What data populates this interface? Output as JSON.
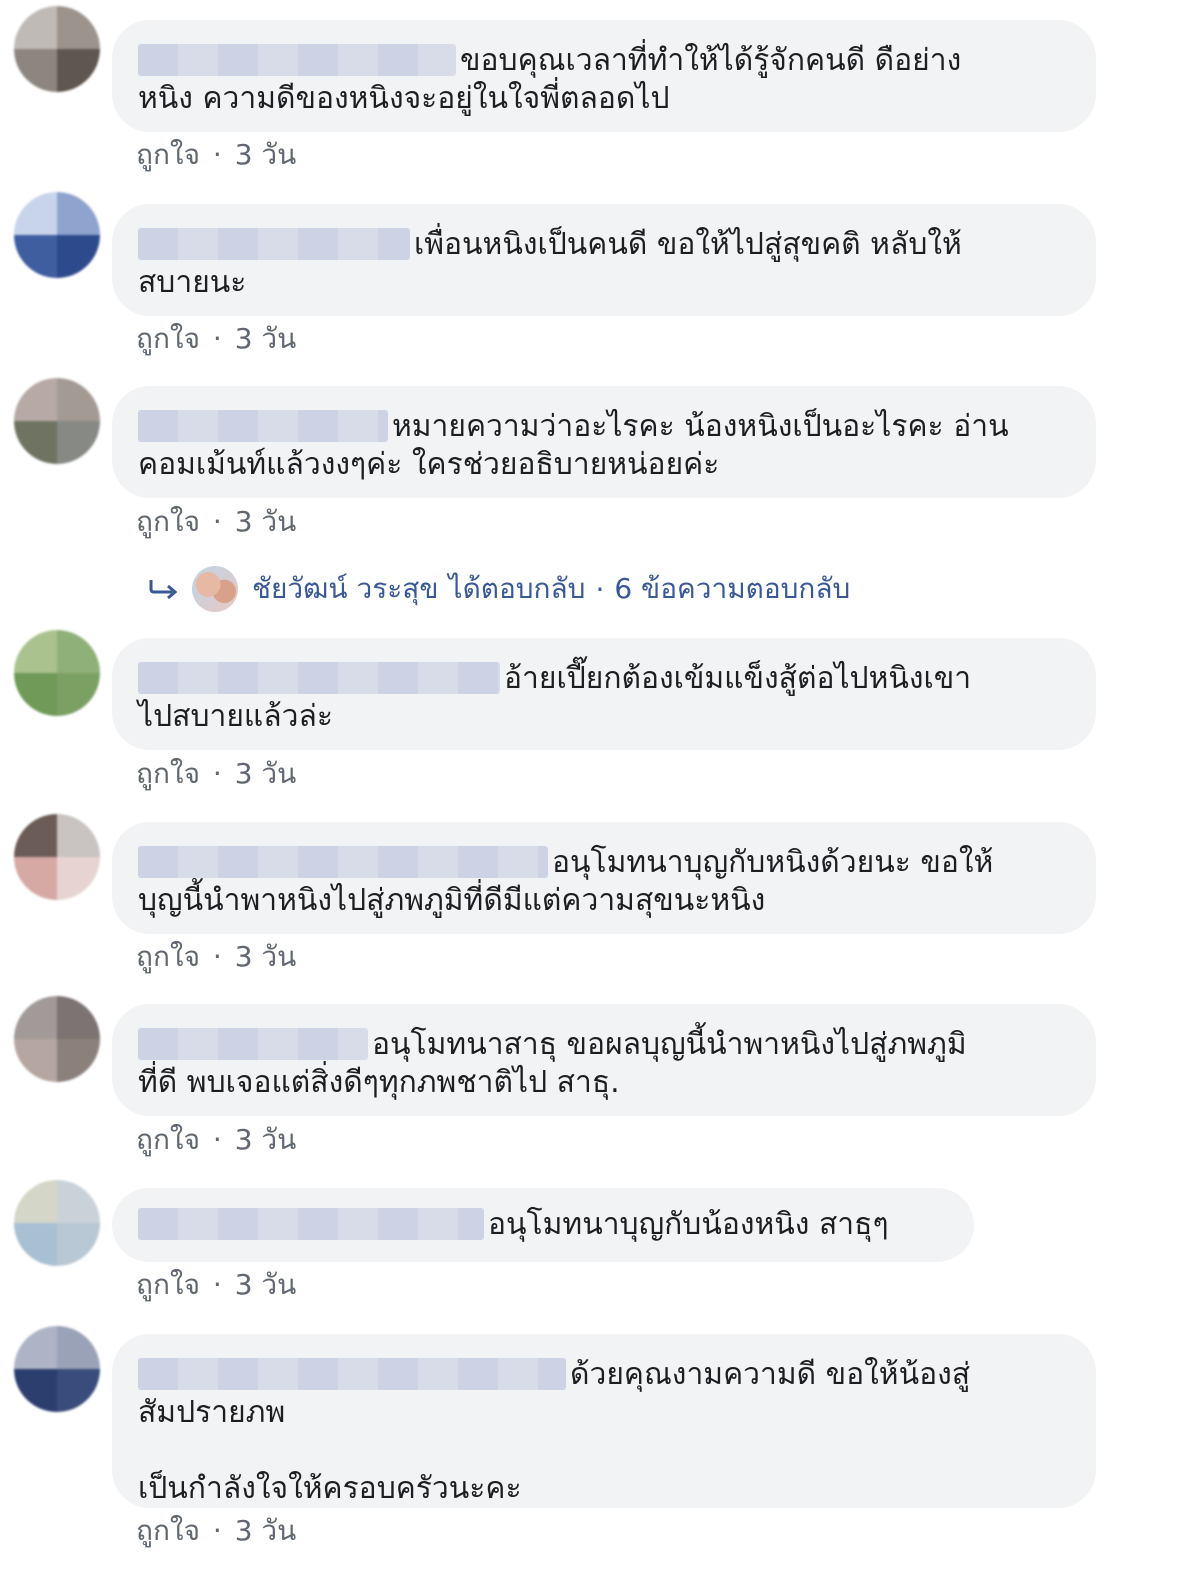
{
  "meta": {
    "like_label": "ถูกใจ",
    "separator": "·",
    "time": "3 วัน"
  },
  "comments": [
    {
      "text": "ขอบคุณเวลาที่ทำให้ได้รู้จักคนดี ดือย่าง\nหนิง ความดีของหนิงจะอยู่ในใจพี่ตลอดไป"
    },
    {
      "text": "เพื่อนหนิงเป็นคนดี ขอให้ไปสู่สุขคติ หลับให้\nสบายนะ"
    },
    {
      "text": "หมายความว่าอะไรคะ น้องหนิงเป็นอะไรคะ อ่าน\nคอมเม้นท์แล้วงงๆค่ะ ใครช่วยอธิบายหน่อยค่ะ"
    },
    {
      "text": "อ้ายเปี๊ยกต้องเข้มแข็งสู้ต่อไปหนิงเขา\nไปสบายแล้วล่ะ"
    },
    {
      "text": "อนุโมทนาบุญกับหนิงด้วยนะ ขอให้\nบุญนี้นำพาหนิงไปสู่ภพภูมิที่ดีมีแต่ความสุขนะหนิง"
    },
    {
      "text": "อนุโมทนาสาธุ ขอผลบุญนี้นำพาหนิงไปสู่ภพภูมิ\nที่ดี พบเจอแต่สิ่งดีๆทุกภพชาติไป สาธุ."
    },
    {
      "text": "อนุโมทนาบุญกับน้องหนิง สาธุๆ"
    },
    {
      "text": "ด้วยคุณงามความดี ขอให้น้องสู่\nสัมปรายภพ\n\nเป็นกำลังใจให้ครอบครัวนะคะ"
    }
  ],
  "reply": {
    "author": "ชัยวัฒน์ วระสุข",
    "action": "ได้ตอบกลับ",
    "separator": "·",
    "count": "6 ข้อความตอบกลับ"
  },
  "colors": {
    "bubble_bg": "#f2f3f5",
    "meta_text": "#606770",
    "link": "#385898"
  }
}
